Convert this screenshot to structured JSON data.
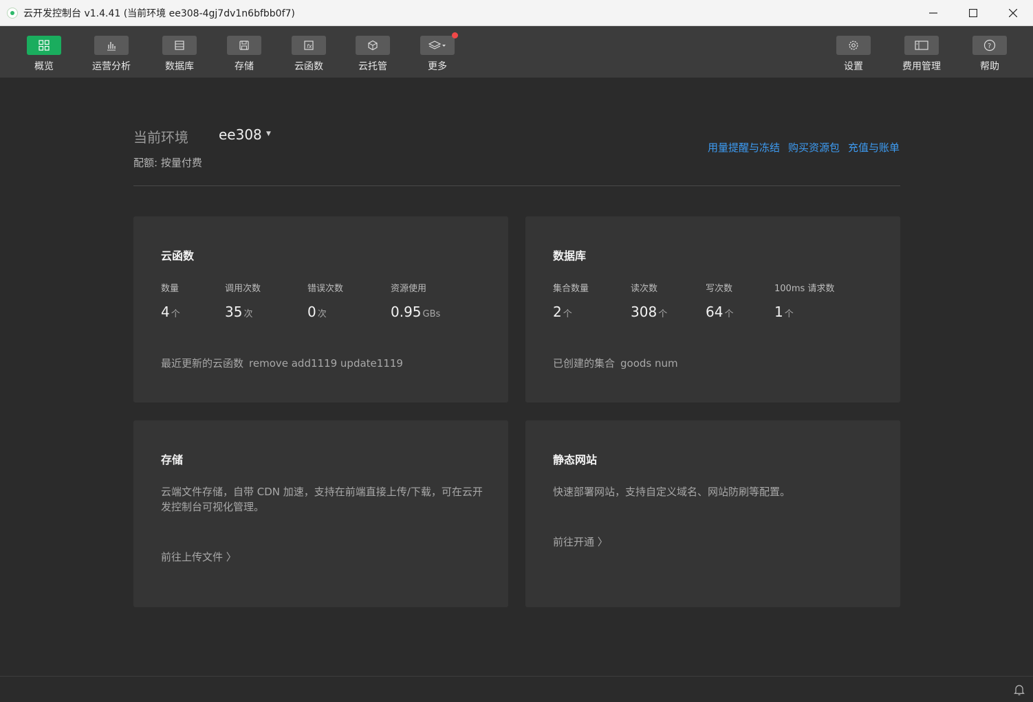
{
  "window": {
    "title": "云开发控制台 v1.4.41  (当前环境 ee308-4gj7dv1n6bfbb0f7)",
    "minimize_icon": "minimize-icon",
    "maximize_icon": "maximize-icon",
    "close_icon": "close-icon"
  },
  "toolbar": {
    "overview": "概览",
    "analytics": "运营分析",
    "database": "数据库",
    "storage": "存储",
    "functions": "云函数",
    "hosting": "云托管",
    "more": "更多",
    "settings": "设置",
    "billing": "费用管理",
    "help": "帮助"
  },
  "env": {
    "label": "当前环境",
    "name": "ee308",
    "caret": "▼",
    "quota": "配额: 按量付费"
  },
  "links": {
    "alert": "用量提醒与冻结",
    "buy": "购买资源包",
    "recharge": "充值与账单"
  },
  "functions_card": {
    "title": "云函数",
    "stats": [
      {
        "label": "数量",
        "value": "4",
        "unit": "个"
      },
      {
        "label": "调用次数",
        "value": "35",
        "unit": "次"
      },
      {
        "label": "错误次数",
        "value": "0",
        "unit": "次"
      },
      {
        "label": "资源使用",
        "value": "0.95",
        "unit": "GBs"
      }
    ],
    "recent_label": "最近更新的云函数",
    "recent_names": "remove  add1119  update1119"
  },
  "database_card": {
    "title": "数据库",
    "stats": [
      {
        "label": "集合数量",
        "value": "2",
        "unit": "个"
      },
      {
        "label": "读次数",
        "value": "308",
        "unit": "个"
      },
      {
        "label": "写次数",
        "value": "64",
        "unit": "个"
      },
      {
        "label": "100ms 请求数",
        "value": "1",
        "unit": "个"
      }
    ],
    "created_label": "已创建的集合",
    "created_names": "goods  num"
  },
  "storage_card": {
    "title": "存储",
    "desc": "云端文件存储，自带 CDN 加速，支持在前端直接上传/下载，可在云开发控制台可视化管理。",
    "link": "前往上传文件 〉"
  },
  "static_card": {
    "title": "静态网站",
    "desc": "快速部署网站，支持自定义域名、网站防刷等配置。",
    "link": "前往开通 〉"
  },
  "colors": {
    "accent_green": "#1aad5e",
    "link_blue": "#3d9bf2",
    "badge_red": "#f04848"
  }
}
